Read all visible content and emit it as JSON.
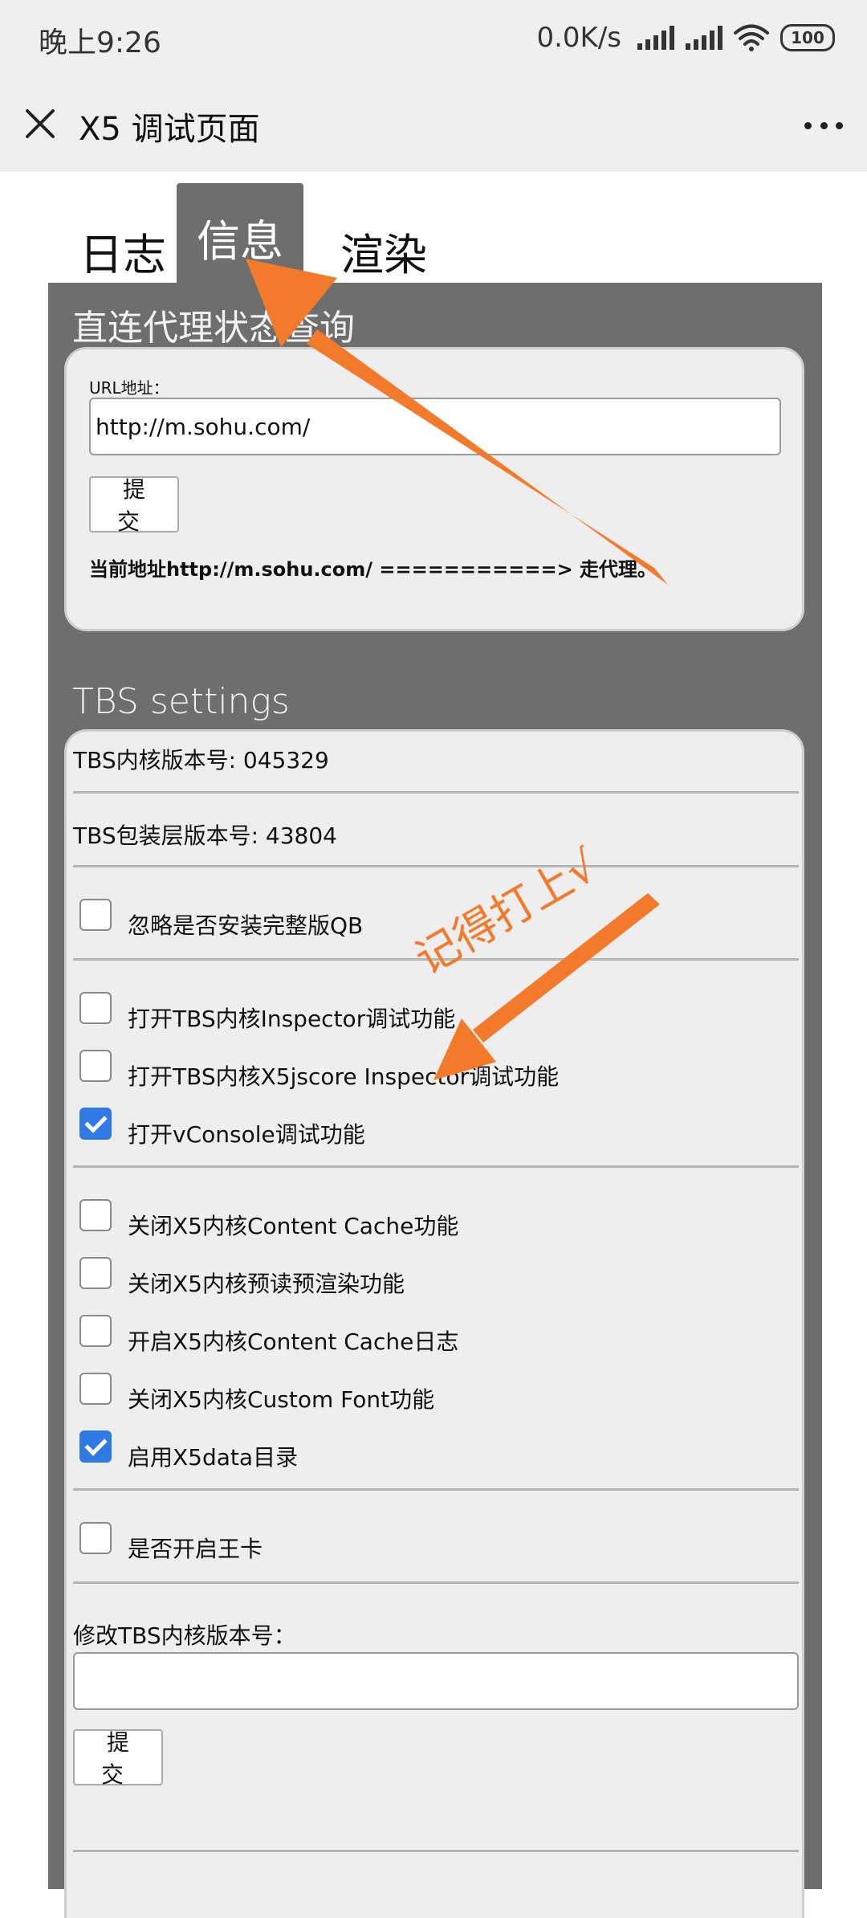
{
  "status_bar": {
    "time": "晚上9:26",
    "network_speed": "0.0K/s",
    "battery": "100"
  },
  "title_bar": {
    "title": "X5 调试页面"
  },
  "tabs": [
    {
      "label": "日志",
      "active": false
    },
    {
      "label": "信息",
      "active": true
    },
    {
      "label": "渲染",
      "active": false
    }
  ],
  "proxy_section": {
    "title": "直连代理状态查询",
    "url_label": "URL地址：",
    "url_value": "http://m.sohu.com/",
    "submit_label": "提交",
    "status_text": "当前地址http://m.sohu.com/ ===========> 走代理。"
  },
  "tbs_section": {
    "title": "TBS settings",
    "kernel_version": "TBS内核版本号: 045329",
    "shell_version": "TBS包装层版本号: 43804",
    "checkbox_groups": [
      [
        {
          "label": "忽略是否安装完整版QB",
          "checked": false
        }
      ],
      [
        {
          "label": "打开TBS内核Inspector调试功能",
          "checked": false
        },
        {
          "label": "打开TBS内核X5jscore Inspector调试功能",
          "checked": false
        },
        {
          "label": "打开vConsole调试功能",
          "checked": true
        }
      ],
      [
        {
          "label": "关闭X5内核Content Cache功能",
          "checked": false
        },
        {
          "label": "关闭X5内核预读预渲染功能",
          "checked": false
        },
        {
          "label": "开启X5内核Content Cache日志",
          "checked": false
        },
        {
          "label": "关闭X5内核Custom Font功能",
          "checked": false
        },
        {
          "label": "启用X5data目录",
          "checked": true
        }
      ],
      [
        {
          "label": "是否开启王卡",
          "checked": false
        }
      ]
    ],
    "modify_kernel_label": "修改TBS内核版本号：",
    "modify_kernel_value": "",
    "submit_label": "提交"
  },
  "annotation": {
    "text": "记得打上√",
    "color": "#f27a2a"
  },
  "colors": {
    "panel_bg": "#6e6e6e",
    "card_bg": "#eeeeee",
    "checkbox_checked": "#2f7ae5",
    "arrow": "#f27a2a"
  }
}
